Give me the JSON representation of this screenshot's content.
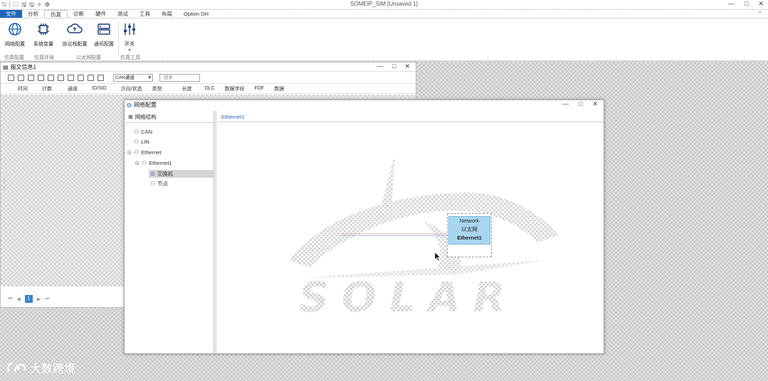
{
  "app": {
    "title": "SOMEIP_SIM [Unsaved 1]",
    "quick_access": [
      "⎋",
      "🗀",
      "🖫",
      "🖫",
      "✧",
      "⚙"
    ],
    "window_controls": [
      "—",
      "□",
      "✕"
    ]
  },
  "ribbon_tabs": [
    "文件",
    "分析",
    "仿真",
    "诊断",
    "硬件",
    "测试",
    "工具",
    "布局",
    "Option DH"
  ],
  "ribbon_collapse": "⌃",
  "ribbon": {
    "buttons": [
      "网络配置",
      "系统变量",
      "协议栈配置",
      "通讯配置",
      "开关"
    ],
    "groups": [
      "仿真配置",
      "仿真环境",
      "以太网配置",
      "仿真工具"
    ],
    "more": "▾"
  },
  "message_window": {
    "title": "报文信息1",
    "controls": [
      "—",
      "□",
      "✕"
    ],
    "channel": "CAN通道",
    "search_placeholder": "搜索",
    "columns": [
      "时间",
      "计数",
      "通道",
      "ID/SID",
      "方向/状态",
      "类型",
      "长度",
      "DLC",
      "数据字段",
      "FDF",
      "数据"
    ],
    "page_current": "1",
    "pager_prev": [
      "⏮",
      "◀"
    ],
    "pager_next": [
      "▶",
      "⏭"
    ]
  },
  "network_window": {
    "title": "网络配置",
    "controls": [
      "—",
      "□",
      "✕"
    ],
    "left_header": "网络结构",
    "tree": {
      "can": "CAN",
      "lin": "LIN",
      "ethernet": "Ethernet",
      "ethernet1": "Ethernet1",
      "switch": "交换机",
      "node": "节点",
      "toggle_expanded": "⊟"
    },
    "canvas_tab": "Ethernet1",
    "node_box": {
      "line1": "Network",
      "line2": "以太网",
      "line3": "Ethernet1"
    },
    "watermark_text": "SOLAR"
  },
  "screen_watermark": "大数跨境",
  "colors": {
    "file_tab": "#1f66b8",
    "node_fill": "#a8d6f0",
    "accent": "#1f66b8"
  }
}
